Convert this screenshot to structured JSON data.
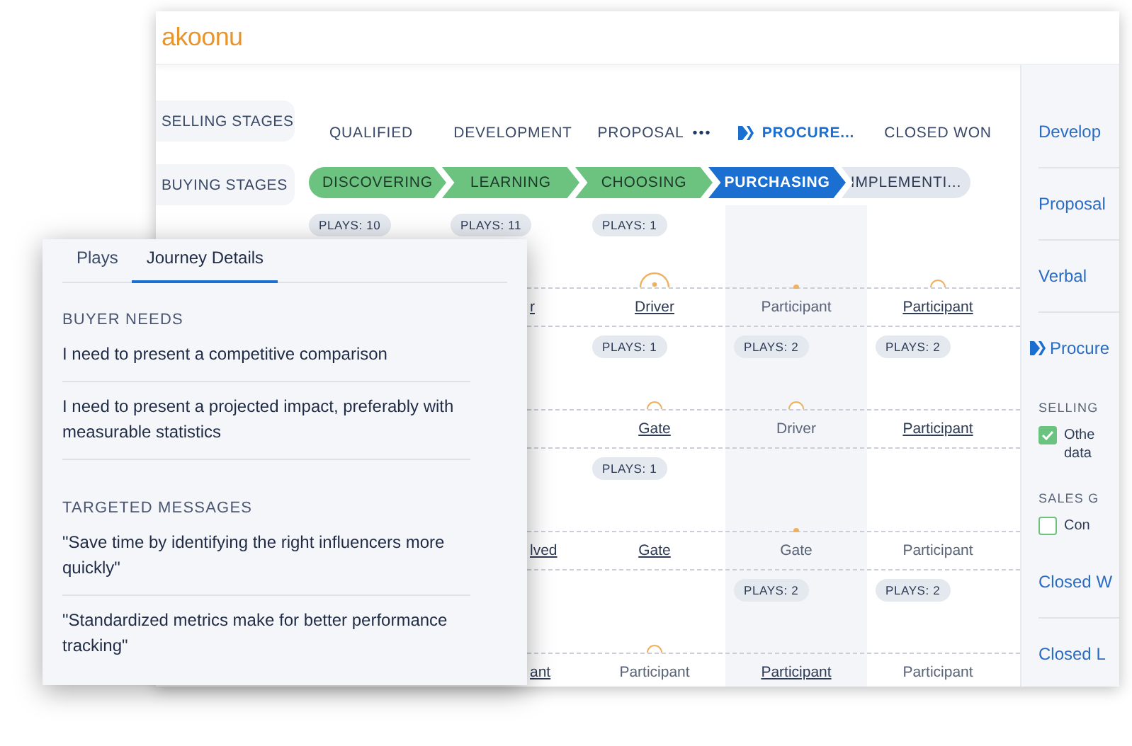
{
  "logo": "akoonu",
  "stage_labels": [
    {
      "label": "SELLING STAGES"
    },
    {
      "label": "BUYING STAGES"
    }
  ],
  "selling_stages": [
    {
      "label": "QUALIFIED",
      "current": false
    },
    {
      "label": "DEVELOPMENT",
      "current": false
    },
    {
      "label": "PROPOSAL",
      "current": false,
      "more": "•••"
    },
    {
      "label": "PROCURE...",
      "current": true
    },
    {
      "label": "CLOSED WON",
      "current": false
    }
  ],
  "buying_stages": [
    {
      "label": "DISCOVERING",
      "kind": "complete"
    },
    {
      "label": "LEARNING",
      "kind": "complete"
    },
    {
      "label": "CHOOSING",
      "kind": "complete"
    },
    {
      "label": "PURCHASING",
      "kind": "current"
    },
    {
      "label": "IMPLEMENTI...",
      "kind": "upcoming"
    }
  ],
  "grid_rows": [
    {
      "cells": [
        {
          "plays": "PLAYS: 10"
        },
        {
          "plays": "PLAYS: 11",
          "role": {
            "text": "r",
            "link": true
          }
        },
        {
          "plays": "PLAYS: 1",
          "role": {
            "text": "Driver",
            "link": true
          },
          "marker": {
            "kind": "ring-large"
          }
        },
        {
          "role": {
            "text": "Participant",
            "link": false
          },
          "marker": {
            "kind": "dot"
          }
        },
        {
          "role": {
            "text": "Participant",
            "link": true
          },
          "marker": {
            "kind": "ring"
          }
        }
      ]
    },
    {
      "cells": [
        {},
        {},
        {
          "plays": "PLAYS: 1",
          "role": {
            "text": "Gate",
            "link": true
          },
          "marker": {
            "kind": "ring"
          }
        },
        {
          "plays": "PLAYS: 2",
          "role": {
            "text": "Driver",
            "link": false
          },
          "marker": {
            "kind": "ring"
          }
        },
        {
          "plays": "PLAYS: 2",
          "role": {
            "text": "Participant",
            "link": true
          }
        }
      ]
    },
    {
      "cells": [
        {},
        {
          "role": {
            "text": "lved",
            "link": true
          }
        },
        {
          "plays": "PLAYS: 1",
          "role": {
            "text": "Gate",
            "link": true
          }
        },
        {
          "role": {
            "text": "Gate",
            "link": false
          },
          "marker": {
            "kind": "dot"
          }
        },
        {
          "role": {
            "text": "Participant",
            "link": false
          }
        }
      ]
    },
    {
      "cells": [
        {},
        {
          "role": {
            "text": "ant",
            "link": true
          }
        },
        {
          "role": {
            "text": "Participant",
            "link": false
          },
          "marker": {
            "kind": "ring"
          }
        },
        {
          "plays": "PLAYS: 2",
          "role": {
            "text": "Participant",
            "link": true
          }
        },
        {
          "plays": "PLAYS: 2",
          "role": {
            "text": "Participant",
            "link": false
          }
        }
      ]
    }
  ],
  "sidebar": [
    {
      "kind": "link",
      "label": "Develop"
    },
    {
      "kind": "link",
      "label": "Proposal"
    },
    {
      "kind": "link",
      "label": "Verbal"
    },
    {
      "kind": "current",
      "label": "Procure"
    },
    {
      "kind": "heading",
      "label": "SELLING"
    },
    {
      "kind": "check",
      "label": "Othe data",
      "checked": true
    },
    {
      "kind": "heading",
      "label": "SALES G"
    },
    {
      "kind": "check",
      "label": "Con",
      "checked": false
    },
    {
      "kind": "link",
      "label": "Closed W"
    },
    {
      "kind": "link",
      "label": "Closed L"
    }
  ],
  "panel": {
    "tabs": [
      {
        "label": "Plays",
        "selected": false
      },
      {
        "label": "Journey Details",
        "selected": true
      }
    ],
    "sections": [
      {
        "heading": "BUYER NEEDS",
        "items": [
          "I need to present a competitive comparison",
          "I need to present a projected impact, preferably with measurable statistics"
        ]
      },
      {
        "heading": "TARGETED MESSAGES",
        "items": [
          "\"Save time by identifying the right influencers more quickly\"",
          "\"Standardized metrics make for better performance tracking\""
        ]
      }
    ]
  }
}
